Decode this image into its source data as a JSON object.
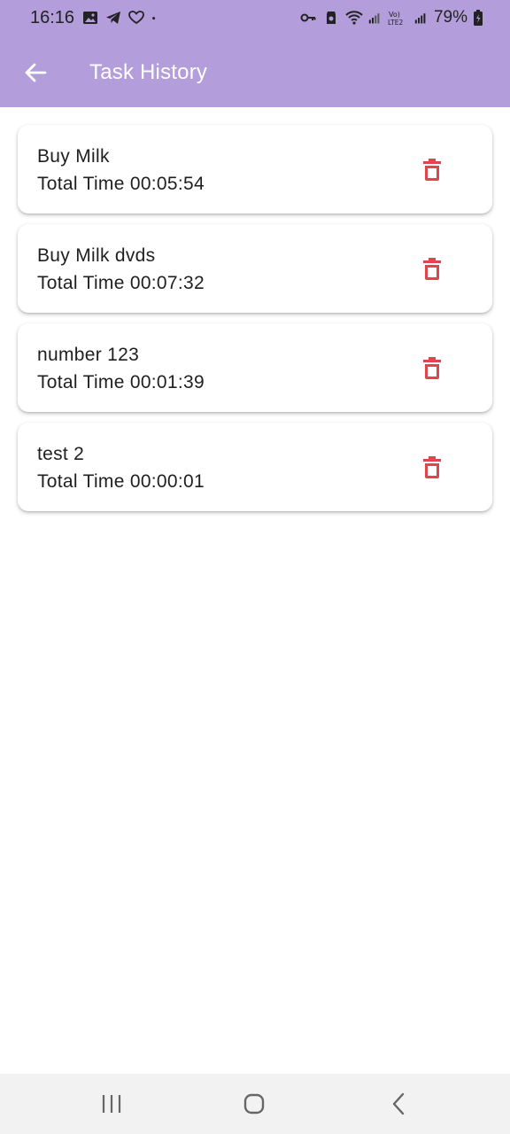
{
  "status_bar": {
    "time": "16:16",
    "battery": "79%",
    "left_icons": [
      "gallery-icon",
      "telegram-icon",
      "heart-chat-icon",
      "dot-icon"
    ],
    "right_icons": [
      "key-icon",
      "shield-icon",
      "wifi-icon",
      "signal-icon",
      "volte-icon",
      "signal-icon",
      "battery-icon"
    ]
  },
  "app_bar": {
    "title": "Task History",
    "background": "#b39ddb"
  },
  "tasks": [
    {
      "name": "Buy Milk",
      "time": "Total Time 00:05:54"
    },
    {
      "name": "Buy Milk dvds",
      "time": "Total Time 00:07:32"
    },
    {
      "name": "number 123",
      "time": "Total Time 00:01:39"
    },
    {
      "name": "test 2",
      "time": "Total Time 00:00:01"
    }
  ],
  "colors": {
    "accent": "#b39ddb",
    "delete": "#e0454f"
  },
  "nav_bar": {
    "buttons": [
      "recent-apps-icon",
      "home-icon",
      "back-icon"
    ]
  }
}
